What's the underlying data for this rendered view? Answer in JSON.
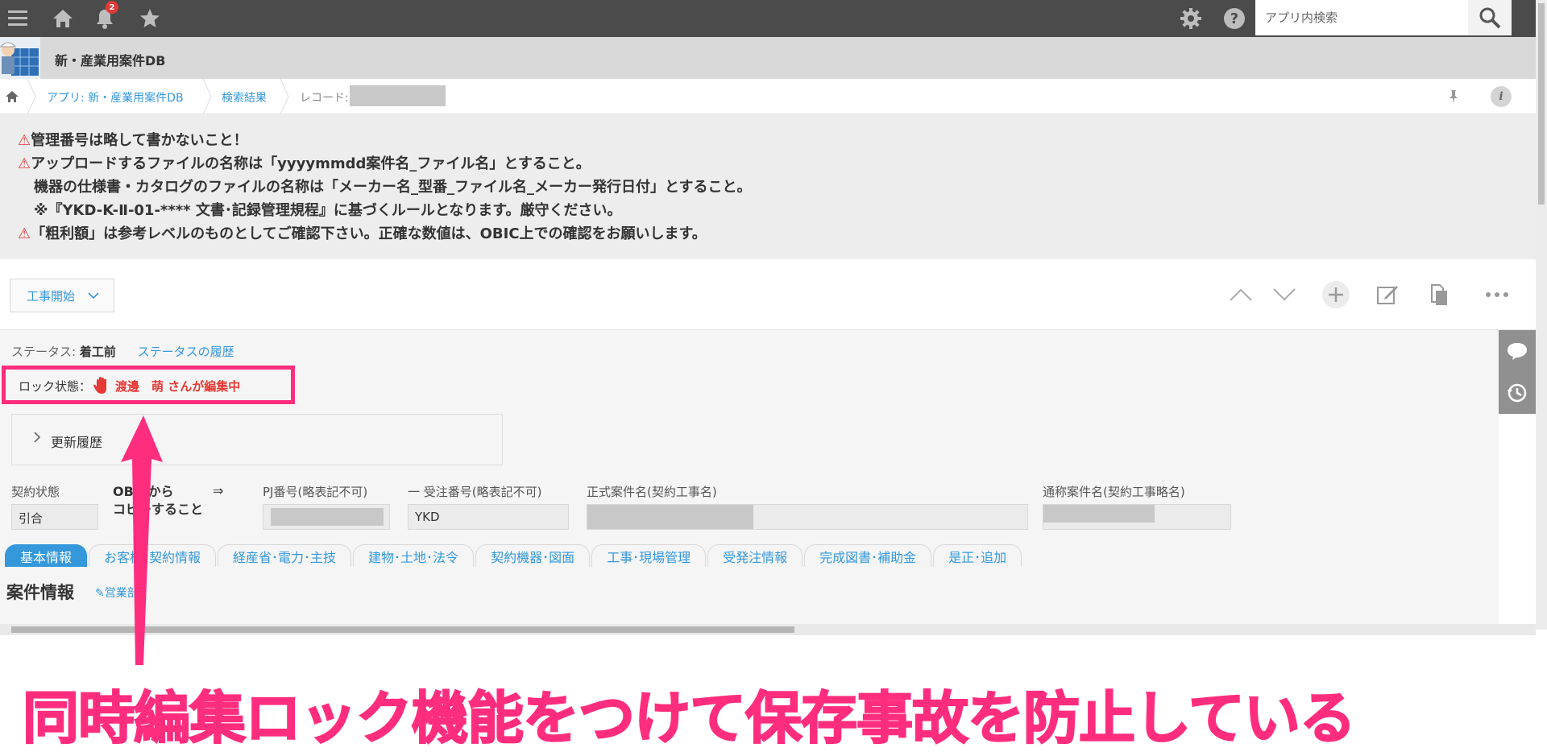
{
  "topbar": {
    "notification_count": "2",
    "search_placeholder": "アプリ内検索"
  },
  "app": {
    "title": "新・産業用案件DB"
  },
  "breadcrumb": {
    "app_link": "アプリ: 新・産業用案件DB",
    "search_results": "検索結果",
    "record_label": "レコード:"
  },
  "notice": {
    "line1": "管理番号は略して書かないこと！",
    "line2": "アップロードするファイルの名称は「yyyymmdd案件名_ファイル名」とすること。",
    "line3": "機器の仕様書・カタログのファイルの名称は「メーカー名_型番_ファイル名_メーカー発行日付」とすること。",
    "line4": "※『YKD-K-Ⅱ-01-**** 文書･記録管理規程』に基づくルールとなります。厳守ください。",
    "line5": "「粗利額」は参考レベルのものとしてご確認下さい。正確な数値は、OBIC上での確認をお願いします。",
    "warn_symbol": "⚠"
  },
  "actionbar": {
    "process_button": "工事開始"
  },
  "record": {
    "status_label": "ステータス:",
    "status_value": "着工前",
    "status_history": "ステータスの履歴",
    "lock_label": "ロック状態：",
    "lock_user": "渡邊　萌 さんが編集中",
    "history_label": "更新履歴",
    "fields": {
      "contract_state_label": "契約状態",
      "contract_state_value": "引合",
      "obic_note_line1": "OBICから",
      "obic_note_line2": "コピーすること",
      "arrow": "⇒",
      "pj_label": "PJ番号(略表記不可)",
      "order_label": "一 受注番号(略表記不可)",
      "order_value": "YKD",
      "official_name_label": "正式案件名(契約工事名)",
      "common_name_label": "通称案件名(契約工事略名)"
    },
    "tabs": [
      "基本情報",
      "お客様･契約情報",
      "経産省･電力･主技",
      "建物･土地･法令",
      "契約機器･図面",
      "工事･現場管理",
      "受発注情報",
      "完成図書･補助金",
      "是正･追加"
    ],
    "section_title": "案件情報",
    "section_link": "✎営業部"
  },
  "annotation": {
    "caption": "同時編集ロック機能をつけて保存事故を防止している"
  },
  "colors": {
    "topbar": "#4b4b4b",
    "accent": "#3498db",
    "highlight": "#ff2d7e",
    "warning": "#e53935"
  }
}
